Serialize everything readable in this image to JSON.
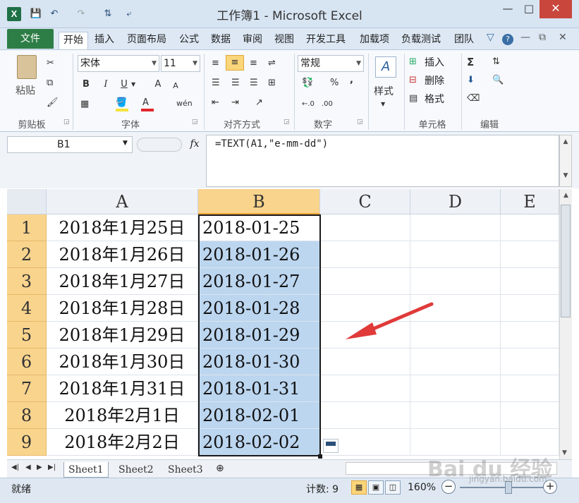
{
  "window": {
    "title": "工作簿1 - Microsoft Excel",
    "app_icon": "X",
    "minimize": "—",
    "maximize": "□",
    "close": "✕"
  },
  "qat": {
    "save_icon": "💾",
    "undo_icon": "↶",
    "redo_icon": "↷",
    "sort_icon": "⇅",
    "custom_icon": "⤶"
  },
  "tabs": [
    {
      "label": "文件"
    },
    {
      "label": "开始"
    },
    {
      "label": "插入"
    },
    {
      "label": "页面布局"
    },
    {
      "label": "公式"
    },
    {
      "label": "数据"
    },
    {
      "label": "审阅"
    },
    {
      "label": "视图"
    },
    {
      "label": "开发工具"
    },
    {
      "label": "加载项"
    },
    {
      "label": "负载测试"
    },
    {
      "label": "团队"
    }
  ],
  "ribbon": {
    "clipboard": {
      "paste": "粘贴",
      "label": "剪贴板"
    },
    "font": {
      "name": "宋体",
      "size": "11",
      "bold": "B",
      "italic": "I",
      "underline": "U",
      "grow": "A",
      "shrink": "A",
      "wen": "wén",
      "label": "字体"
    },
    "alignment": {
      "label": "对齐方式"
    },
    "number": {
      "format": "常规",
      "percent": "%",
      "comma": ",",
      "inc": "←.0",
      "dec": ".00",
      "label": "数字"
    },
    "styles": {
      "label": "样式"
    },
    "cells": {
      "insert": "插入",
      "delete": "删除",
      "format": "格式",
      "label": "单元格"
    },
    "editing": {
      "sigma": "Σ",
      "label": "编辑"
    }
  },
  "formula_bar": {
    "name_box": "B1",
    "fx": "fx",
    "formula": "=TEXT(A1,\"e-mm-dd\")"
  },
  "columns": [
    "A",
    "B",
    "C",
    "D",
    "E"
  ],
  "rows": [
    {
      "num": "1",
      "a": "2018年1月25日",
      "b": "2018-01-25"
    },
    {
      "num": "2",
      "a": "2018年1月26日",
      "b": "2018-01-26"
    },
    {
      "num": "3",
      "a": "2018年1月27日",
      "b": "2018-01-27"
    },
    {
      "num": "4",
      "a": "2018年1月28日",
      "b": "2018-01-28"
    },
    {
      "num": "5",
      "a": "2018年1月29日",
      "b": "2018-01-29"
    },
    {
      "num": "6",
      "a": "2018年1月30日",
      "b": "2018-01-30"
    },
    {
      "num": "7",
      "a": "2018年1月31日",
      "b": "2018-01-31"
    },
    {
      "num": "8",
      "a": "2018年2月1日",
      "b": "2018-02-01"
    },
    {
      "num": "9",
      "a": "2018年2月2日",
      "b": "2018-02-02"
    }
  ],
  "sheets": [
    {
      "label": "Sheet1"
    },
    {
      "label": "Sheet2"
    },
    {
      "label": "Sheet3"
    }
  ],
  "status": {
    "ready": "就绪",
    "count": "计数: 9",
    "zoom": "160%",
    "minus": "−",
    "plus": "+"
  },
  "watermark": {
    "brand": "Bai du 经验",
    "site": "jingyan.baidu.com"
  },
  "colors": {
    "accent_green": "#2d7d46",
    "selection_blue": "#bcd6f0",
    "header_highlight": "#f9d48d",
    "arrow_red": "#e03a3a"
  }
}
